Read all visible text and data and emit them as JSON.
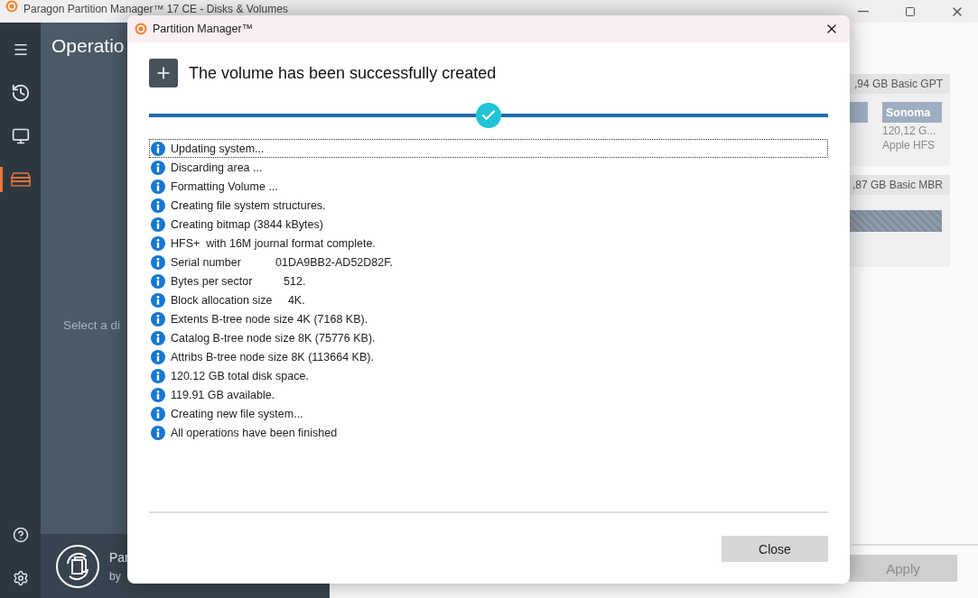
{
  "window": {
    "title": "Paragon Partition Manager™ 17 CE - Disks & Volumes"
  },
  "sidebar": {
    "items": [
      {
        "kind": "menu",
        "selected": false
      },
      {
        "kind": "history",
        "selected": false
      },
      {
        "kind": "devices",
        "selected": false
      },
      {
        "kind": "disks",
        "selected": true
      }
    ],
    "bottom": [
      {
        "kind": "help"
      },
      {
        "kind": "settings"
      }
    ]
  },
  "left_panel": {
    "heading": "Operatio",
    "hint": "Select a di",
    "footer": {
      "name": "Par",
      "byline": "by"
    }
  },
  "disks": [
    {
      "header": ",94 GB Basic GPT",
      "partitions": [
        {
          "kind": "volume"
        },
        {
          "kind": "volume",
          "label": "Sonoma",
          "size": "120,12 G...",
          "fs": "Apple HFS"
        }
      ]
    },
    {
      "header": ",87 GB Basic MBR",
      "partitions": [
        {
          "kind": "unallocated"
        }
      ]
    }
  ],
  "apply_button": {
    "label": "Apply",
    "disabled": true
  },
  "dialog": {
    "title": "Partition Manager™",
    "heading": "The volume has been successfully created",
    "complete": true,
    "log": [
      {
        "text": "Updating system...",
        "selected": true
      },
      {
        "text": "Discarding area ...",
        "selected": false
      },
      {
        "text": "Formatting Volume ...",
        "selected": false
      },
      {
        "text": "Creating file system structures.",
        "selected": false
      },
      {
        "text": "Creating bitmap (3844 kBytes)",
        "selected": false
      },
      {
        "text": "HFS+  with 16M journal format complete.",
        "selected": false
      },
      {
        "text": "Serial number           01DA9BB2-AD52D82F.",
        "selected": false
      },
      {
        "text": "Bytes per sector          512.",
        "selected": false
      },
      {
        "text": "Block allocation size     4K.",
        "selected": false
      },
      {
        "text": "Extents B-tree node size 4K (7168 KB).",
        "selected": false
      },
      {
        "text": "Catalog B-tree node size 8K (75776 KB).",
        "selected": false
      },
      {
        "text": "Attribs B-tree node size 8K (113664 KB).",
        "selected": false
      },
      {
        "text": "120.12 GB total disk space.",
        "selected": false
      },
      {
        "text": "119.91 GB available.",
        "selected": false
      },
      {
        "text": "Creating new file system...",
        "selected": false
      },
      {
        "text": "All operations have been finished",
        "selected": false
      }
    ],
    "close_button": "Close"
  }
}
